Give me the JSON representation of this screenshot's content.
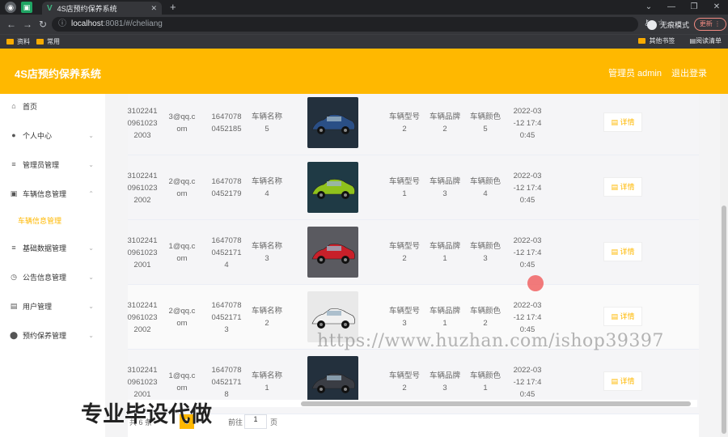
{
  "browser": {
    "tab_title": "4S店预约保养系统",
    "url_host": "localhost",
    "url_path": ":8081/#/cheliang",
    "incognito_label": "无痕模式",
    "update_label": "更新",
    "bookmarks": [
      "资料",
      "常用"
    ],
    "bookmarks_right": [
      "其他书签",
      "阅读清单"
    ]
  },
  "header": {
    "title": "4S店预约保养系统",
    "admin": "管理员 admin",
    "logout": "退出登录",
    "accent": "#ffb800"
  },
  "sidebar": {
    "items": [
      {
        "label": "首页",
        "icon": "home-icon",
        "chevron": ""
      },
      {
        "label": "个人中心",
        "icon": "user-icon",
        "chevron": "⌄"
      },
      {
        "label": "管理员管理",
        "icon": "list-icon",
        "chevron": "⌄"
      },
      {
        "label": "车辆信息管理",
        "icon": "car-icon",
        "chevron": "⌃"
      },
      {
        "label": "基础数据管理",
        "icon": "list-icon",
        "chevron": "⌄"
      },
      {
        "label": "公告信息管理",
        "icon": "clock-icon",
        "chevron": "⌄"
      },
      {
        "label": "用户管理",
        "icon": "user-box-icon",
        "chevron": "⌄"
      },
      {
        "label": "预约保养管理",
        "icon": "pin-icon",
        "chevron": "⌄"
      }
    ],
    "sub_active": "车辆信息管理"
  },
  "table": {
    "detail_label": "详情",
    "rows": [
      {
        "id": [
          "3102241",
          "0961023",
          "2003"
        ],
        "email": [
          "3@qq.c",
          "om"
        ],
        "phone": [
          "1647078",
          "0452185"
        ],
        "name": [
          "车辆名称",
          "5"
        ],
        "model": [
          "车辆型号",
          "2"
        ],
        "brand": [
          "车辆品牌",
          "2"
        ],
        "color": [
          "车辆颜色",
          "5"
        ],
        "time": [
          "2022-03",
          "-12 17:4",
          "0:45"
        ],
        "car_color": "#2a4f86"
      },
      {
        "id": [
          "3102241",
          "0961023",
          "2002"
        ],
        "email": [
          "2@qq.c",
          "om"
        ],
        "phone": [
          "1647078",
          "0452179"
        ],
        "name": [
          "车辆名称",
          "4"
        ],
        "model": [
          "车辆型号",
          "1"
        ],
        "brand": [
          "车辆品牌",
          "3"
        ],
        "color": [
          "车辆颜色",
          "4"
        ],
        "time": [
          "2022-03",
          "-12 17:4",
          "0:45"
        ],
        "car_color": "#8fc21c"
      },
      {
        "id": [
          "3102241",
          "0961023",
          "2001"
        ],
        "email": [
          "1@qq.c",
          "om"
        ],
        "phone": [
          "1647078",
          "0452171",
          "4"
        ],
        "name": [
          "车辆名称",
          "3"
        ],
        "model": [
          "车辆型号",
          "2"
        ],
        "brand": [
          "车辆品牌",
          "1"
        ],
        "color": [
          "车辆颜色",
          "3"
        ],
        "time": [
          "2022-03",
          "-12 17:4",
          "0:45"
        ],
        "car_color": "#c8202a"
      },
      {
        "id": [
          "3102241",
          "0961023",
          "2002"
        ],
        "email": [
          "2@qq.c",
          "om"
        ],
        "phone": [
          "1647078",
          "0452171",
          "3"
        ],
        "name": [
          "车辆名称",
          "2"
        ],
        "model": [
          "车辆型号",
          "3"
        ],
        "brand": [
          "车辆品牌",
          "1"
        ],
        "color": [
          "车辆颜色",
          "2"
        ],
        "time": [
          "2022-03",
          "-12 17:4",
          "0:45"
        ],
        "car_color": "#f0f0f0"
      },
      {
        "id": [
          "3102241",
          "0961023",
          "2001"
        ],
        "email": [
          "1@qq.c",
          "om"
        ],
        "phone": [
          "1647078",
          "0452171",
          "8"
        ],
        "name": [
          "车辆名称",
          "1"
        ],
        "model": [
          "车辆型号",
          "2"
        ],
        "brand": [
          "车辆品牌",
          "3"
        ],
        "color": [
          "车辆颜色",
          "1"
        ],
        "time": [
          "2022-03",
          "-12 17:4",
          "0:45"
        ],
        "car_color": "#3a3d44"
      }
    ]
  },
  "pager": {
    "total": "共 6 条",
    "current_page": "1",
    "goto_label": "前往",
    "goto_value": "1",
    "goto_unit": "页"
  },
  "watermark": "https://www.huzhan.com/ishop39397",
  "overlay_caption": "专业毕设代做"
}
